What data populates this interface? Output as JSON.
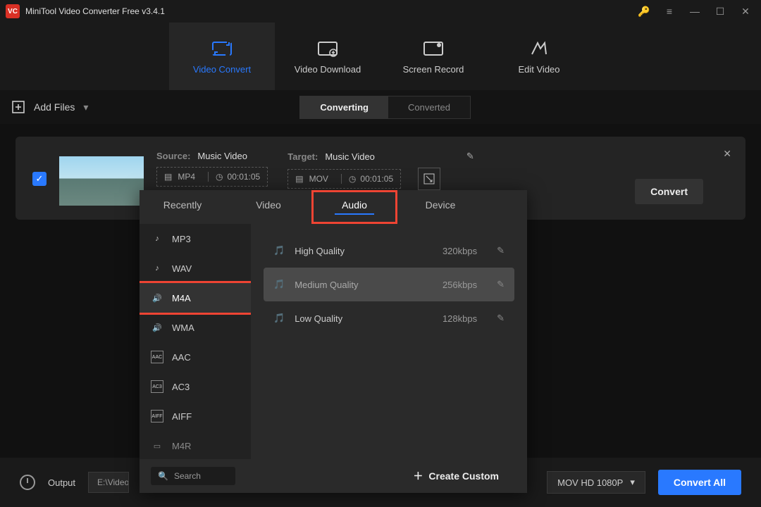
{
  "app": {
    "title": "MiniTool Video Converter Free v3.4.1",
    "logo_text": "VC"
  },
  "main_tabs": [
    {
      "label": "Video Convert",
      "active": true
    },
    {
      "label": "Video Download",
      "active": false
    },
    {
      "label": "Screen Record",
      "active": false
    },
    {
      "label": "Edit Video",
      "active": false
    }
  ],
  "toolbar": {
    "add_files": "Add Files"
  },
  "segments": {
    "converting": "Converting",
    "converted": "Converted"
  },
  "item": {
    "source": {
      "label": "Source:",
      "name": "Music Video",
      "format": "MP4",
      "duration": "00:01:05"
    },
    "target": {
      "label": "Target:",
      "name": "Music Video",
      "format": "MOV",
      "duration": "00:01:05"
    },
    "convert_btn": "Convert"
  },
  "popover": {
    "tabs": [
      "Recently",
      "Video",
      "Audio",
      "Device"
    ],
    "active_tab_index": 2,
    "formats": [
      "MP3",
      "WAV",
      "M4A",
      "WMA",
      "AAC",
      "AC3",
      "AIFF",
      "M4R"
    ],
    "selected_format_index": 2,
    "qualities": [
      {
        "label": "High Quality",
        "bitrate": "320kbps"
      },
      {
        "label": "Medium Quality",
        "bitrate": "256kbps"
      },
      {
        "label": "Low Quality",
        "bitrate": "128kbps"
      }
    ],
    "selected_quality_index": 1,
    "search_placeholder": "Search",
    "create_custom": "Create Custom"
  },
  "bottom": {
    "output_label": "Output",
    "output_path": "E:\\Video",
    "preset": "MOV HD 1080P",
    "convert_all": "Convert All"
  }
}
